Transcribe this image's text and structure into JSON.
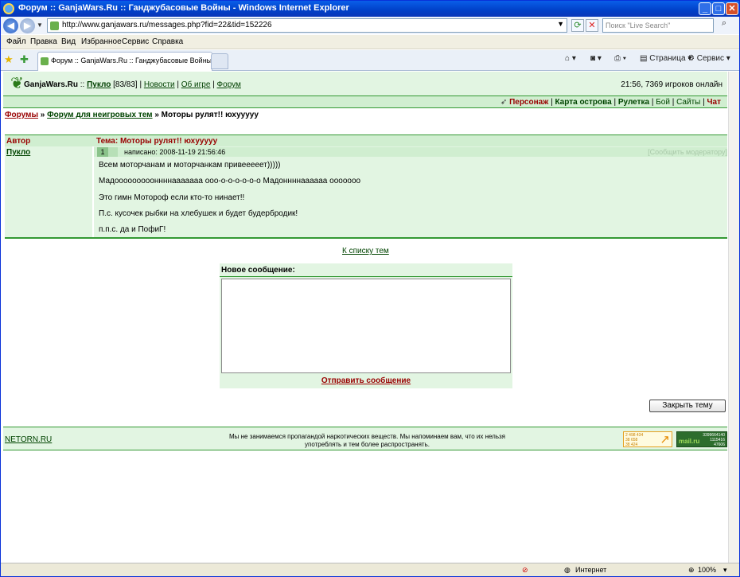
{
  "window": {
    "title": "Форум :: GanjaWars.Ru :: Ганджубасовые Войны - Windows Internet Explorer"
  },
  "browser": {
    "url": "http://www.ganjawars.ru/messages.php?fid=22&tid=152226",
    "search_placeholder": "Поиск \"Live Search\"",
    "menu": [
      "Файл",
      "Правка",
      "Вид",
      "Избранное",
      "Сервис",
      "Справка"
    ],
    "tab_title": "Форум :: GanjaWars.Ru :: Ганджубасовые Войны",
    "toolbar": {
      "page": "Страница",
      "tools": "Сервис"
    },
    "status": {
      "zone": "Интернет",
      "zoom": "100%"
    }
  },
  "site": {
    "name": "GanjaWars.Ru",
    "sep": "::",
    "user": "Пукло",
    "level": "[83/83]",
    "nav": [
      "Новости",
      "Об игре",
      "Форум"
    ],
    "online": "21:56, 7369 игроков онлайн"
  },
  "nav2": [
    "Персонаж",
    "Карта острова",
    "Рулетка",
    "Бой",
    "Сайты",
    "Чат"
  ],
  "breadcrumb": {
    "forums": "Форумы",
    "section": "Форум для неигровых тем",
    "topic": "Моторы рулят!! юхууууу"
  },
  "thread": {
    "col_author": "Автор",
    "col_topic": "Тема: Моторы рулят!! юхууууу",
    "post": {
      "author": "Пукло",
      "number": "1",
      "date": "написано: 2008-11-19 21:56:46",
      "report": "[Сообщить модератору]",
      "lines": [
        "Всем моторчанам и моторчанкам привеееeет)))))",
        "Мадоооооооооннннааааааа ооо-о-о-о-о-о-о Мадоннннааааaa ооооооо",
        "Это гимн Моторoф если кто-то нинает!!",
        "П.с. кусочек рыбки на хлебушек и будет будербродик!",
        "п.п.с. да и ПофиГ!"
      ]
    }
  },
  "back_link": "К списку тем",
  "new_message": {
    "title": "Новое сообщение:",
    "textarea": "",
    "submit": "Отправить сообщение"
  },
  "close_topic": "Закрыть тему",
  "footer": {
    "link": "NETORN.RU",
    "text": "Мы не занимаемся пропагандой наркотических веществ. Мы напоминаем вам, что их нельзя употреблять и тем более распространять.",
    "counter1": [
      "2 498 434",
      "38 658",
      "38 424"
    ],
    "counter2": {
      "brand": "mail.ru",
      "values": [
        "3399664140",
        "1115416",
        "47606"
      ]
    }
  },
  "colors": {
    "accent": "#990000",
    "green_dark": "#004400",
    "bg_light": "#e2f5e2",
    "bg_mid": "#d0eed0"
  }
}
